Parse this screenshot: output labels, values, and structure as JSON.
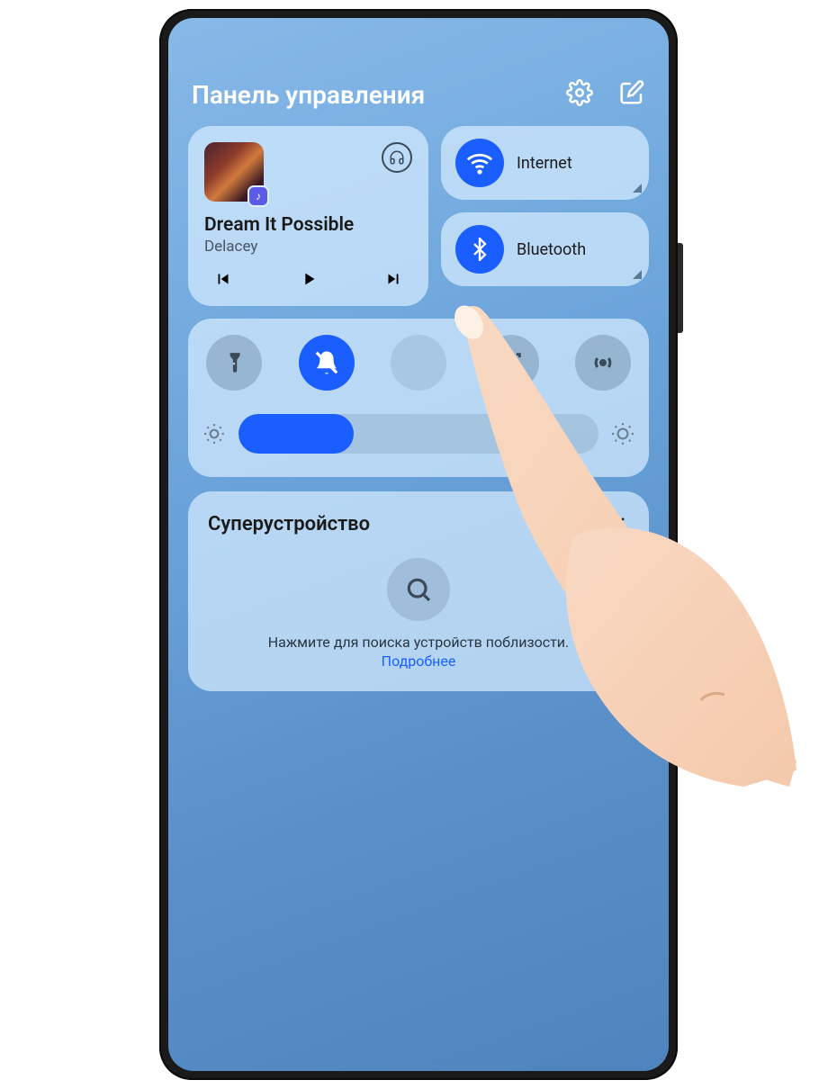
{
  "header": {
    "title": "Панель управления"
  },
  "music": {
    "title": "Dream It Possible",
    "artist": "Delacey"
  },
  "connectivity": {
    "wifi": {
      "label": "Internet",
      "active": true
    },
    "bluetooth": {
      "label": "Bluetooth",
      "active": true
    }
  },
  "toggles": {
    "flashlight": {
      "active": false
    },
    "mute": {
      "active": true
    },
    "screenshot": {
      "active": false
    },
    "hotspot": {
      "active": false
    }
  },
  "brightness": {
    "value_pct": 32
  },
  "super_device": {
    "title": "Суперустройство",
    "hint": "Нажмите для поиска устройств поблизости.",
    "link": "Подробнее"
  }
}
